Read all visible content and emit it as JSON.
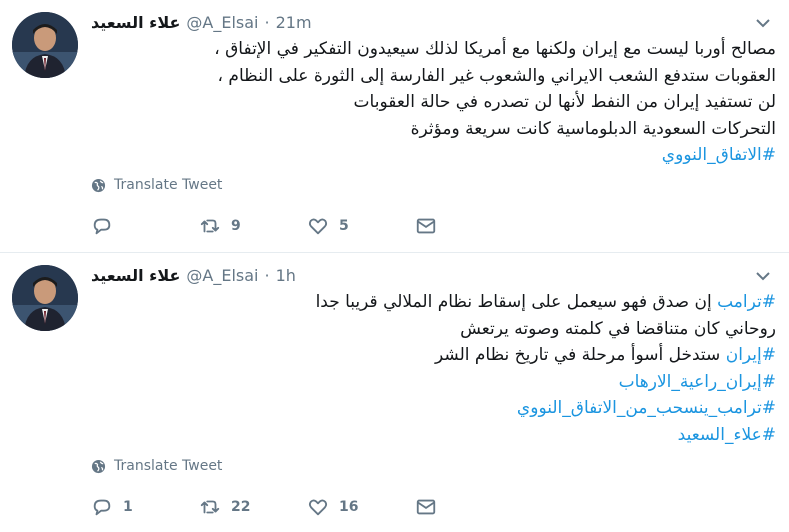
{
  "tweets": [
    {
      "author_name": "علاء السعيد",
      "handle": "@A_Elsai",
      "separator": "·",
      "time": "21m",
      "lines": [
        {
          "text": "مصالح أوربا ليست مع إيران ولكنها مع أمريكا لذلك سيعيدون التفكير في الإتفاق ،",
          "hashtag": false
        },
        {
          "text": "العقوبات ستدفع الشعب الايراني والشعوب غير الفارسة إلى الثورة على النظام ،",
          "hashtag": false
        },
        {
          "text": "لن تستفيد إيران من النفط لأنها لن تصدره في حالة العقوبات",
          "hashtag": false
        },
        {
          "text": "التحركات السعودية الدبلوماسية كانت سريعة ومؤثرة",
          "hashtag": false
        },
        {
          "text": "#الاتفاق_النووي",
          "hashtag": true
        }
      ],
      "translate_label": "Translate Tweet",
      "reply_count": "",
      "retweet_count": "9",
      "like_count": "5"
    },
    {
      "author_name": "علاء السعيد",
      "handle": "@A_Elsai",
      "separator": "·",
      "time": "1h",
      "line1_hashtag": "#ترامب",
      "line1_text": " إن صدق فهو سيعمل على إسقاط نظام الملالي قريبا جدا",
      "line2_text": "روحاني كان متناقضا في كلمته وصوته يرتعش",
      "line3_hashtag": "#إيران",
      "line3_text": " ستدخل أسوأ مرحلة في تاريخ نظام الشر",
      "line4_hashtag": "#إيران_راعية_الارهاب",
      "line5_hashtag": "#ترامب_ينسحب_من_الاتفاق_النووي",
      "line6_hashtag": "#علاء_السعيد",
      "translate_label": "Translate Tweet",
      "reply_count": "1",
      "retweet_count": "22",
      "like_count": "16"
    }
  ],
  "icons": {
    "caret": "chevron-down-icon",
    "globe": "globe-icon",
    "reply": "reply-icon",
    "retweet": "retweet-icon",
    "like": "heart-icon",
    "message": "envelope-icon"
  },
  "colors": {
    "hashtag": "#1b95e0",
    "secondary_text": "#657786",
    "divider": "#e6ecf0"
  }
}
